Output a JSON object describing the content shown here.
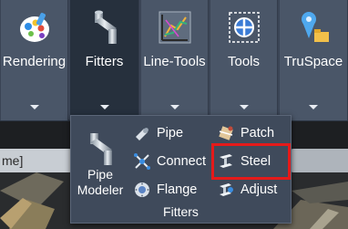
{
  "ribbon": {
    "buttons": [
      {
        "label": "Rendering",
        "icon": "rendering-icon"
      },
      {
        "label": "Fitters",
        "icon": "pipe-fitters-icon"
      },
      {
        "label": "Line-Tools",
        "icon": "line-tools-icon"
      },
      {
        "label": "Tools",
        "icon": "tools-target-icon"
      },
      {
        "label": "TruSpace",
        "icon": "truspace-icon"
      }
    ],
    "active": "Fitters"
  },
  "viewport": {
    "left_tab_text": "me]"
  },
  "fitters_panel": {
    "title": "Fitters",
    "pipe_modeler_label_line1": "Pipe",
    "pipe_modeler_label_line2": "Modeler",
    "items": [
      {
        "label": "Pipe",
        "icon": "pipe-segment-icon"
      },
      {
        "label": "Connect",
        "icon": "connect-icon"
      },
      {
        "label": "Flange",
        "icon": "flange-icon"
      },
      {
        "label": "Patch",
        "icon": "patch-icon"
      },
      {
        "label": "Steel",
        "icon": "steel-beam-icon",
        "highlighted": true
      },
      {
        "label": "Adjust",
        "icon": "adjust-icon"
      }
    ],
    "highlight_color": "#e51a1a"
  },
  "colors": {
    "ribbon_bg": "#4a5668",
    "ribbon_active_bg": "#26303d",
    "panel_bg": "#3f4a5b"
  }
}
